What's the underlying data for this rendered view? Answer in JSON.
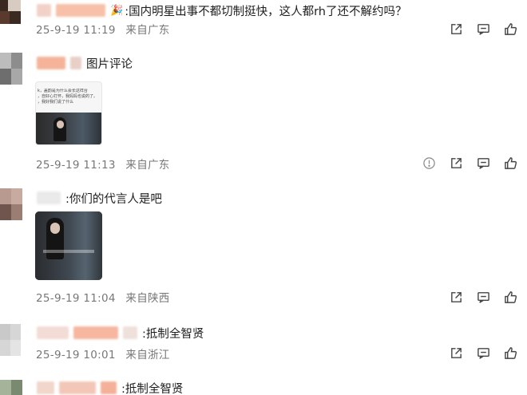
{
  "comments": [
    {
      "text": ":国内明星出事不都切制挺快，这人都rh了还不解约吗？",
      "emoji": "🎉",
      "date": "25-9-19 11:19",
      "location": "来自广东",
      "actions": [
        "share-icon",
        "comment-icon",
        "like-icon"
      ]
    },
    {
      "text": "图片评论",
      "date": "25-9-19 11:13",
      "location": "来自广东",
      "image_caption_lines": [
        "k，盖韵是为什么会长这样台",
        "，自好心打怀，我妈妈也说的了。",
        "，我好我们说了什么"
      ],
      "actions": [
        "info-icon",
        "share-icon",
        "comment-icon",
        "like-icon"
      ]
    },
    {
      "text": ":你们的代言人是吧",
      "date": "25-9-19 11:04",
      "location": "来自陕西",
      "actions": [
        "share-icon",
        "comment-icon",
        "like-icon"
      ]
    },
    {
      "text": ":抵制全智贤",
      "date": "25-9-19 10:01",
      "location": "来自浙江",
      "actions": [
        "share-icon",
        "comment-icon",
        "like-icon"
      ]
    },
    {
      "text": ":抵制全智贤"
    }
  ]
}
